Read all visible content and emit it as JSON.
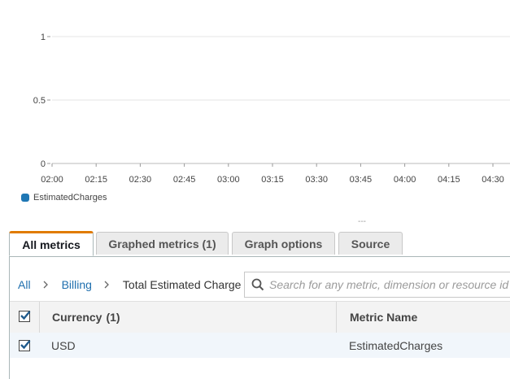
{
  "chart_data": {
    "type": "line",
    "x": [
      "02:00",
      "02:15",
      "02:30",
      "02:45",
      "03:00",
      "03:15",
      "03:30",
      "03:45",
      "04:00",
      "04:15",
      "04:30"
    ],
    "ylim": [
      0,
      1
    ],
    "y_ticks": [
      "1",
      "0.5",
      "0"
    ],
    "series": [
      {
        "name": "EstimatedCharges",
        "values": [],
        "color": "#1f77b4"
      }
    ],
    "grid": true,
    "legend": "bottom-left"
  },
  "resize_handle": "---",
  "tabs": [
    {
      "label": "All metrics",
      "active": true
    },
    {
      "label": "Graphed metrics (1)",
      "active": false
    },
    {
      "label": "Graph options",
      "active": false
    },
    {
      "label": "Source",
      "active": false
    }
  ],
  "breadcrumb": {
    "all": "All",
    "billing": "Billing",
    "current": "Total Estimated Charge"
  },
  "search": {
    "placeholder": "Search for any metric, dimension or resource id",
    "icon": "search-icon"
  },
  "table": {
    "headers": {
      "currency": "Currency",
      "currency_count": "(1)",
      "metric_name": "Metric Name"
    },
    "rows": [
      {
        "currency": "USD",
        "metric": "EstimatedCharges",
        "checked": true
      }
    ],
    "select_all_checked": true
  },
  "colors": {
    "accent_tab": "#e07b00",
    "link": "#1f6fae",
    "series": "#1f77b4"
  }
}
